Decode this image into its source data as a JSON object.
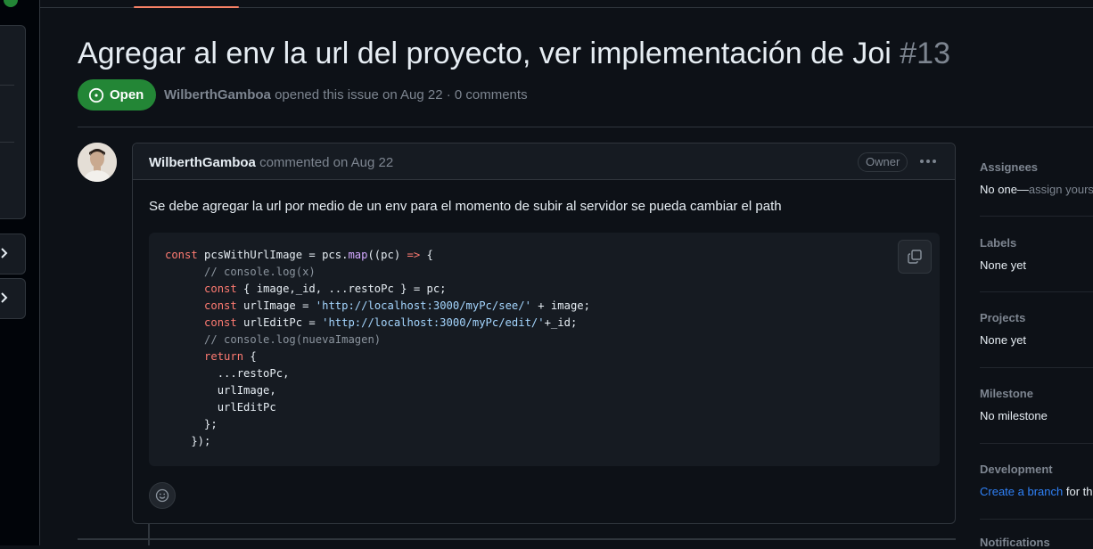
{
  "issue": {
    "title": "Agregar al env la url del proyecto, ver implementación de Joi",
    "number": "#13",
    "state": "Open",
    "author": "WilberthGamboa",
    "meta_text": "opened this issue on Aug 22 · 0 comments"
  },
  "comment": {
    "author": "WilberthGamboa",
    "action": "commented on Aug 22",
    "role_badge": "Owner",
    "body": "Se debe agregar la url por medio de un env para el momento de subir al servidor se pueda cambiar el path",
    "code": [
      [
        {
          "t": "kw",
          "v": "const"
        },
        {
          "t": "",
          "v": " pcsWithUrlImage = pcs."
        },
        {
          "t": "fn",
          "v": "map"
        },
        {
          "t": "",
          "v": "((pc) "
        },
        {
          "t": "kw",
          "v": "=>"
        },
        {
          "t": "",
          "v": " {"
        }
      ],
      [
        {
          "t": "cm",
          "v": "      // console.log(x)"
        }
      ],
      [
        {
          "t": "",
          "v": "      "
        },
        {
          "t": "kw",
          "v": "const"
        },
        {
          "t": "",
          "v": " { image,_id, ...restoPc } = pc;"
        }
      ],
      [
        {
          "t": "",
          "v": "      "
        },
        {
          "t": "kw",
          "v": "const"
        },
        {
          "t": "",
          "v": " urlImage = "
        },
        {
          "t": "str",
          "v": "'http://localhost:3000/myPc/see/'"
        },
        {
          "t": "",
          "v": " + image;"
        }
      ],
      [
        {
          "t": "",
          "v": "      "
        },
        {
          "t": "kw",
          "v": "const"
        },
        {
          "t": "",
          "v": " urlEditPc = "
        },
        {
          "t": "str",
          "v": "'http://localhost:3000/myPc/edit/'"
        },
        {
          "t": "",
          "v": "+_id;"
        }
      ],
      [
        {
          "t": "cm",
          "v": "      // console.log(nuevaImagen)"
        }
      ],
      [
        {
          "t": "",
          "v": "      "
        },
        {
          "t": "kw",
          "v": "return"
        },
        {
          "t": "",
          "v": " {"
        }
      ],
      [
        {
          "t": "",
          "v": "        ...restoPc,"
        }
      ],
      [
        {
          "t": "",
          "v": "        urlImage,"
        }
      ],
      [
        {
          "t": "",
          "v": "        urlEditPc"
        }
      ],
      [
        {
          "t": "",
          "v": "      };"
        }
      ],
      [
        {
          "t": "",
          "v": "    });"
        }
      ]
    ]
  },
  "sidebar": {
    "assignees": {
      "title": "Assignees",
      "value": "No one—",
      "link": "assign yours"
    },
    "labels": {
      "title": "Labels",
      "value": "None yet"
    },
    "projects": {
      "title": "Projects",
      "value": "None yet"
    },
    "milestone": {
      "title": "Milestone",
      "value": "No milestone"
    },
    "development": {
      "title": "Development",
      "link": "Create a branch",
      "value": " for th"
    },
    "notifications": {
      "title": "Notifications"
    }
  },
  "colors": {
    "open_green": "#238636",
    "link_blue": "#2f81f7",
    "background": "#0d1117"
  }
}
